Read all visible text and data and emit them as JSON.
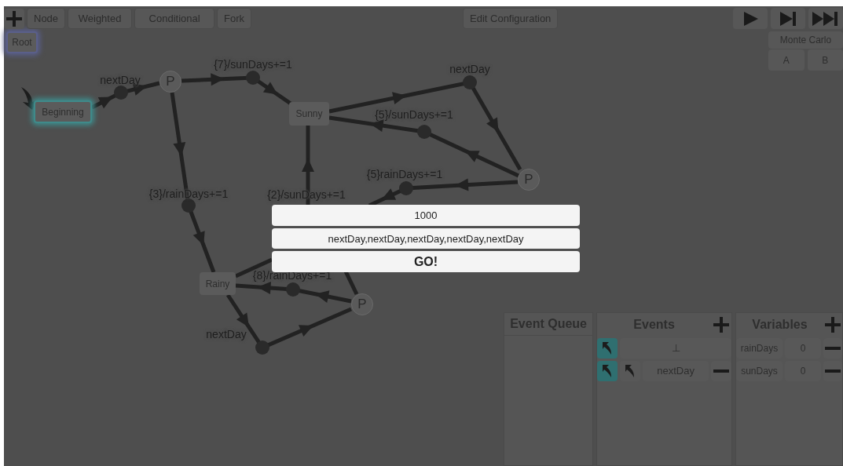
{
  "toolbar": {
    "buttons": [
      "Node",
      "Weighted",
      "Conditional",
      "Fork"
    ],
    "edit_button": "Edit Configuration"
  },
  "monte_carlo": {
    "label": "Monte Carlo",
    "buttons": [
      "A",
      "B"
    ]
  },
  "graph": {
    "nodes": [
      {
        "kind": "state",
        "label": "Root",
        "color": "#5a5f8a"
      },
      {
        "kind": "state",
        "label": "Beginning",
        "color": "#3f8a8a"
      },
      {
        "kind": "state",
        "label": "Sunny"
      },
      {
        "kind": "state",
        "label": "Rainy"
      },
      {
        "kind": "probability",
        "label": "P"
      },
      {
        "kind": "probability",
        "label": "P"
      },
      {
        "kind": "probability",
        "label": "P"
      }
    ],
    "edges": [
      {
        "label": "nextDay"
      },
      {
        "label": "{7}/sunDays+=1"
      },
      {
        "label": "nextDay"
      },
      {
        "label": "{5}/sunDays+=1"
      },
      {
        "label": "{5}rainDays+=1"
      },
      {
        "label": "{3}/rainDays+=1"
      },
      {
        "label": "{2}/sunDays+=1"
      },
      {
        "label": "{8}/rainDays+=1"
      },
      {
        "label": "nextDay"
      }
    ]
  },
  "dialog": {
    "iterations": "1000",
    "sequence": "nextDay,nextDay,nextDay,nextDay,nextDay",
    "go_button": "GO!"
  },
  "event_queue": {
    "title": "Event Queue"
  },
  "events": {
    "title": "Events",
    "rows": [
      {
        "kind": "start",
        "value": "⊥"
      },
      {
        "kind": "event",
        "value": "nextDay"
      }
    ]
  },
  "variables": {
    "title": "Variables",
    "rows": [
      {
        "name": "rainDays",
        "value": "0"
      },
      {
        "name": "sunDays",
        "value": "0"
      }
    ]
  }
}
